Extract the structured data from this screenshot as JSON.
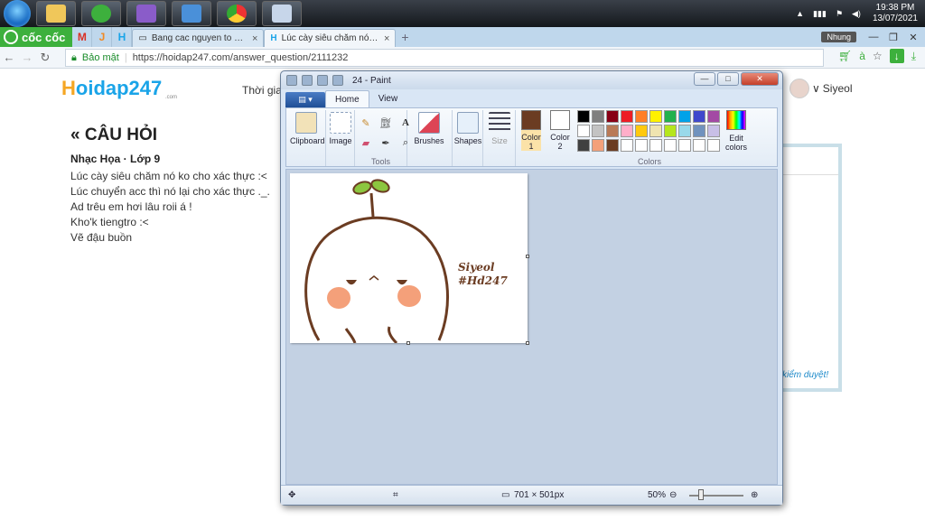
{
  "taskbar": {
    "clock_time": "19:38 PM",
    "clock_date": "13/07/2021"
  },
  "browser": {
    "brand": "cốc cốc",
    "pinned": [
      "M",
      "J",
      "H"
    ],
    "tabs": [
      {
        "title": "Bang cac nguyen to hoa h"
      },
      {
        "title": "Lúc cày siêu chăm nó ko c"
      }
    ],
    "profile": "Nhung",
    "secure_label": "Bảo mật",
    "url": "https://hoidap247.com/answer_question/2111232"
  },
  "site": {
    "logo_h": "H",
    "logo_rest": "oidap247",
    "logo_sub": ".com",
    "nav_time": "Thời gia",
    "username": "Siyeol",
    "heading_glyph": "«",
    "heading": "CÂU HỎI",
    "meta": "Nhạc Họa · Lớp 9",
    "question_lines": [
      "Lúc cày siêu chăm nó ko cho xác thực :<",
      "Lúc chuyển acc thì nó lại cho xác thực ._.",
      "Ad trêu em hơi lâu roii á !",
      "Kho'k tiengtro :<",
      "Vẽ đậu  buồn"
    ],
    "side_note": "kiểm duyệt!"
  },
  "paint": {
    "title": "24 - Paint",
    "tabs": {
      "home": "Home",
      "view": "View"
    },
    "groups": {
      "clipboard": "Clipboard",
      "image": "Image",
      "tools": "Tools",
      "brushes": "Brushes",
      "shapes": "Shapes",
      "size": "Size",
      "colors": "Colors"
    },
    "color1": {
      "label1": "Color",
      "label2": "1",
      "value": "#6b3c22"
    },
    "color2": {
      "label1": "Color",
      "label2": "2",
      "value": "#ffffff"
    },
    "edit_colors": {
      "line1": "Edit",
      "line2": "colors"
    },
    "palette": [
      "#000000",
      "#7f7f7f",
      "#880015",
      "#ed1c24",
      "#ff7f27",
      "#fff200",
      "#22b14c",
      "#00a2e8",
      "#3f48cc",
      "#a349a4",
      "#ffffff",
      "#c3c3c3",
      "#b97a57",
      "#ffaec9",
      "#ffc90e",
      "#efe4b0",
      "#b5e61d",
      "#99d9ea",
      "#7092be",
      "#c8bfe7",
      "#404040",
      "#f4a07a",
      "#6b3c22",
      "#ffffff",
      "#ffffff",
      "#ffffff",
      "#ffffff",
      "#ffffff",
      "#ffffff",
      "#ffffff"
    ],
    "drawing_text": [
      "Siyeol",
      "#Hd247"
    ],
    "status": {
      "dimensions": "701 × 501px",
      "zoom": "50%"
    }
  }
}
